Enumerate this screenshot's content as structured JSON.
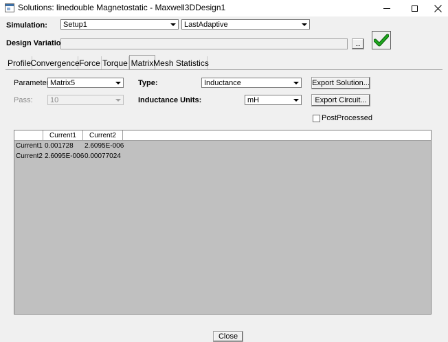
{
  "window": {
    "title": "Solutions: linedouble Magnetostatic - Maxwell3DDesign1"
  },
  "simulation": {
    "label": "Simulation:",
    "setup": "Setup1",
    "pass_type": "LastAdaptive"
  },
  "design_variation": {
    "label": "Design Variation:",
    "value": "",
    "browse_label": "..."
  },
  "tabs": [
    {
      "label": "Profile"
    },
    {
      "label": "Convergence"
    },
    {
      "label": "Force"
    },
    {
      "label": "Torque"
    },
    {
      "label": "Matrix"
    },
    {
      "label": "Mesh Statistics"
    }
  ],
  "active_tab": "Matrix",
  "matrix": {
    "parameter_label": "Parameter:",
    "parameter_value": "Matrix5",
    "pass_label": "Pass:",
    "pass_value": "10",
    "type_label": "Type:",
    "type_value": "Inductance",
    "units_label": "Inductance Units:",
    "units_value": "mH",
    "export_solution_label": "Export Solution...",
    "export_circuit_label": "Export Circuit...",
    "postprocessed_label": "PostProcessed",
    "postprocessed_checked": false
  },
  "grid": {
    "columns": [
      "Current1",
      "Current2"
    ],
    "rows": [
      {
        "name": "Current1",
        "values": [
          "0.001728",
          "2.6095E-006"
        ]
      },
      {
        "name": "Current2",
        "values": [
          "2.6095E-006",
          "0.00077024"
        ]
      }
    ]
  },
  "footer": {
    "close_label": "Close"
  },
  "colors": {
    "accept_check": "#1fa81f",
    "grid_background": "#c0c0c0",
    "window_background": "#f0f0f0"
  }
}
